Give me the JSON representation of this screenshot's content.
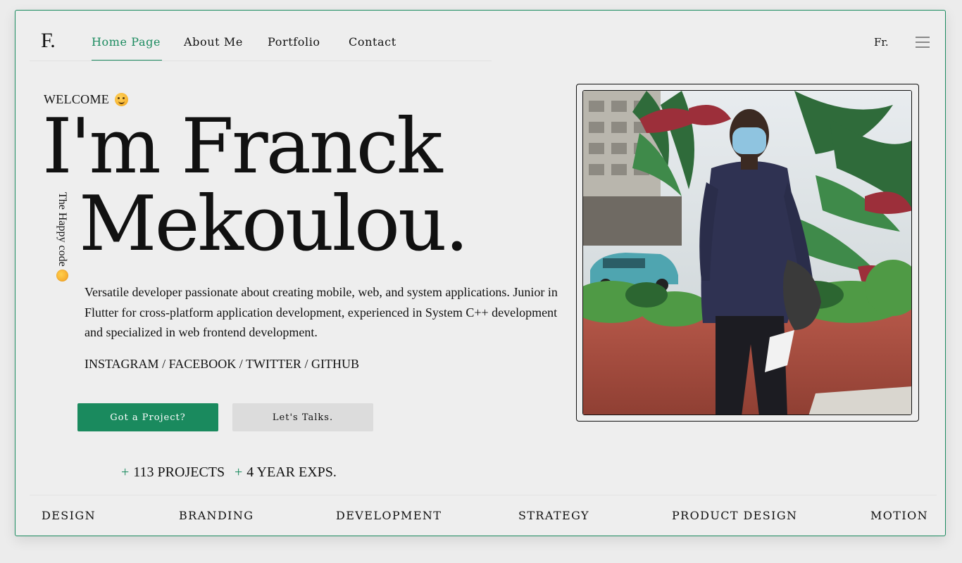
{
  "logo": "F.",
  "nav": {
    "items": [
      {
        "label": "Home Page",
        "active": true
      },
      {
        "label": "About Me",
        "active": false
      },
      {
        "label": "Portfolio",
        "active": false
      },
      {
        "label": "Contact",
        "active": false
      }
    ],
    "lang": "Fr.",
    "menu_icon": "hamburger-icon"
  },
  "hero": {
    "welcome": "WELCOME",
    "welcome_icon": "smiling-face-emoji",
    "name_line1": "I'm Franck",
    "name_line2": "Mekoulou.",
    "tagline": "The Happy code",
    "tagline_icon": "party-face-emoji",
    "intro": "Versatile developer passionate about creating mobile, web, and system applications. Junior in Flutter for cross-platform application development, experienced in System C++ development and specialized in web frontend development.",
    "socials": [
      "INSTAGRAM",
      "FACEBOOK",
      "TWITTER",
      "GITHUB"
    ],
    "buttons": {
      "primary": "Got a Project?",
      "secondary": "Let's Talks."
    },
    "stats": [
      {
        "plus": "+",
        "label": "113 PROJECTS"
      },
      {
        "plus": "+",
        "label": "4 YEAR EXPS."
      }
    ]
  },
  "services": [
    "DESIGN",
    "BRANDING",
    "DEVELOPMENT",
    "STRATEGY",
    "PRODUCT DESIGN",
    "MOTION"
  ],
  "colors": {
    "accent": "#1a8a5e",
    "background": "#eeeeee",
    "text": "#111111"
  }
}
